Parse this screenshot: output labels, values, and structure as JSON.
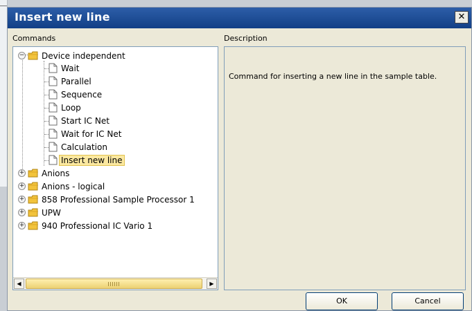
{
  "dialog": {
    "title": "Insert new line",
    "close_glyph": "✕"
  },
  "labels": {
    "commands": "Commands",
    "description": "Description"
  },
  "description_text": "Command for inserting a new line in the sample table.",
  "tree": {
    "root": {
      "label": "Device independent",
      "expanded": true,
      "children": [
        "Wait",
        "Parallel",
        "Sequence",
        "Loop",
        "Start IC Net",
        "Wait for IC Net",
        "Calculation",
        "Insert new line"
      ],
      "selected_child": "Insert new line"
    },
    "other_nodes": [
      "Anions",
      "Anions - logical",
      "858 Professional Sample Processor 1",
      "UPW",
      "940 Professional IC Vario 1"
    ]
  },
  "buttons": {
    "ok": "OK",
    "cancel": "Cancel"
  },
  "colors": {
    "title_bar": "#1c4b94",
    "selection_bg": "#fbe8a0",
    "folder": "#f2c33c",
    "scrollbar_thumb": "#ecd173"
  },
  "icons": {
    "folder": "folder-icon",
    "document": "document-icon",
    "expander": "expander-icon",
    "close": "close-icon"
  }
}
